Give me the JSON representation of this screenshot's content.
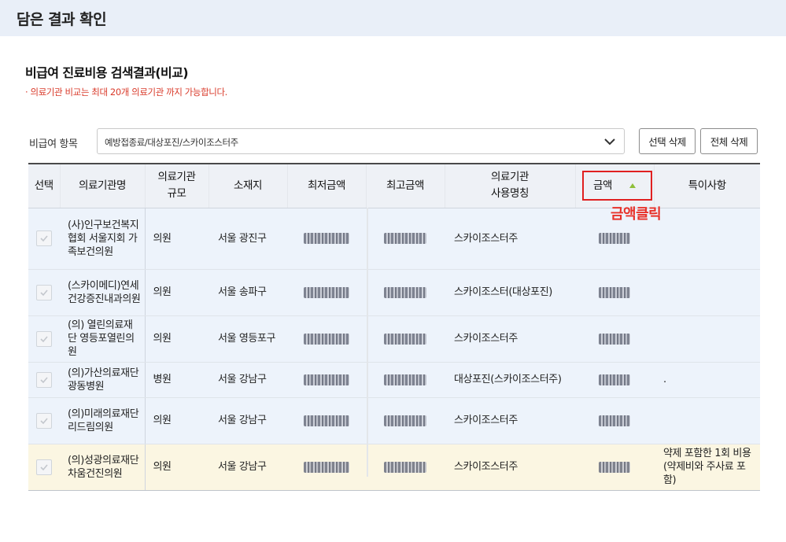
{
  "header": {
    "title": "담은 결과 확인"
  },
  "section": {
    "title": "비급여 진료비용 검색결과(비교)",
    "note": "· 의료기관 비교는 최대 20개 의료기관 까지 가능합니다."
  },
  "filter": {
    "label": "비급여 항목",
    "selected": "예방접종료/대상포진/스카이조스터주",
    "buttons": {
      "delete_selected": "선택 삭제",
      "delete_all": "전체 삭제"
    }
  },
  "table": {
    "headers": {
      "select": "선택",
      "institution": "의료기관명",
      "scale": "의료기관\n규모",
      "location": "소재지",
      "min_price": "최저금액",
      "max_price": "최고금액",
      "usage_name": "의료기관\n사용명칭",
      "amount": "금액",
      "remarks": "특이사항"
    },
    "rows": [
      {
        "name": "(사)인구보건복지협회 서울지회 가족보건의원",
        "scale": "의원",
        "location": "서울 광진구",
        "usage_name": "스카이조스터주",
        "remarks": "",
        "highlight": false
      },
      {
        "name": "(스카이메디)연세건강증진내과의원",
        "scale": "의원",
        "location": "서울 송파구",
        "usage_name": "스카이조스터(대상포진)",
        "remarks": "",
        "highlight": false
      },
      {
        "name": "(의) 열린의료재단 영등포열린의원",
        "scale": "의원",
        "location": "서울 영등포구",
        "usage_name": "스카이조스터주",
        "remarks": "",
        "highlight": false
      },
      {
        "name": "(의)가산의료재단 광동병원",
        "scale": "병원",
        "location": "서울 강남구",
        "usage_name": "대상포진(스카이조스터주)",
        "remarks": ".",
        "highlight": false
      },
      {
        "name": "(의)미래의료재단리드림의원",
        "scale": "의원",
        "location": "서울 강남구",
        "usage_name": "스카이조스터주",
        "remarks": "",
        "highlight": false
      },
      {
        "name": "(의)성광의료재단차움건진의원",
        "scale": "의원",
        "location": "서울 강남구",
        "usage_name": "스카이조스터주",
        "remarks": "약제 포함한 1회 비용(약제비와 주사료 포함)",
        "highlight": true
      }
    ]
  },
  "annotation": {
    "text": "금액클릭"
  },
  "colors": {
    "accent_red": "#e02020",
    "header_bg": "#e9eff8",
    "row_bg": "#edf3fb",
    "highlight_row_bg": "#fbf6e2"
  }
}
